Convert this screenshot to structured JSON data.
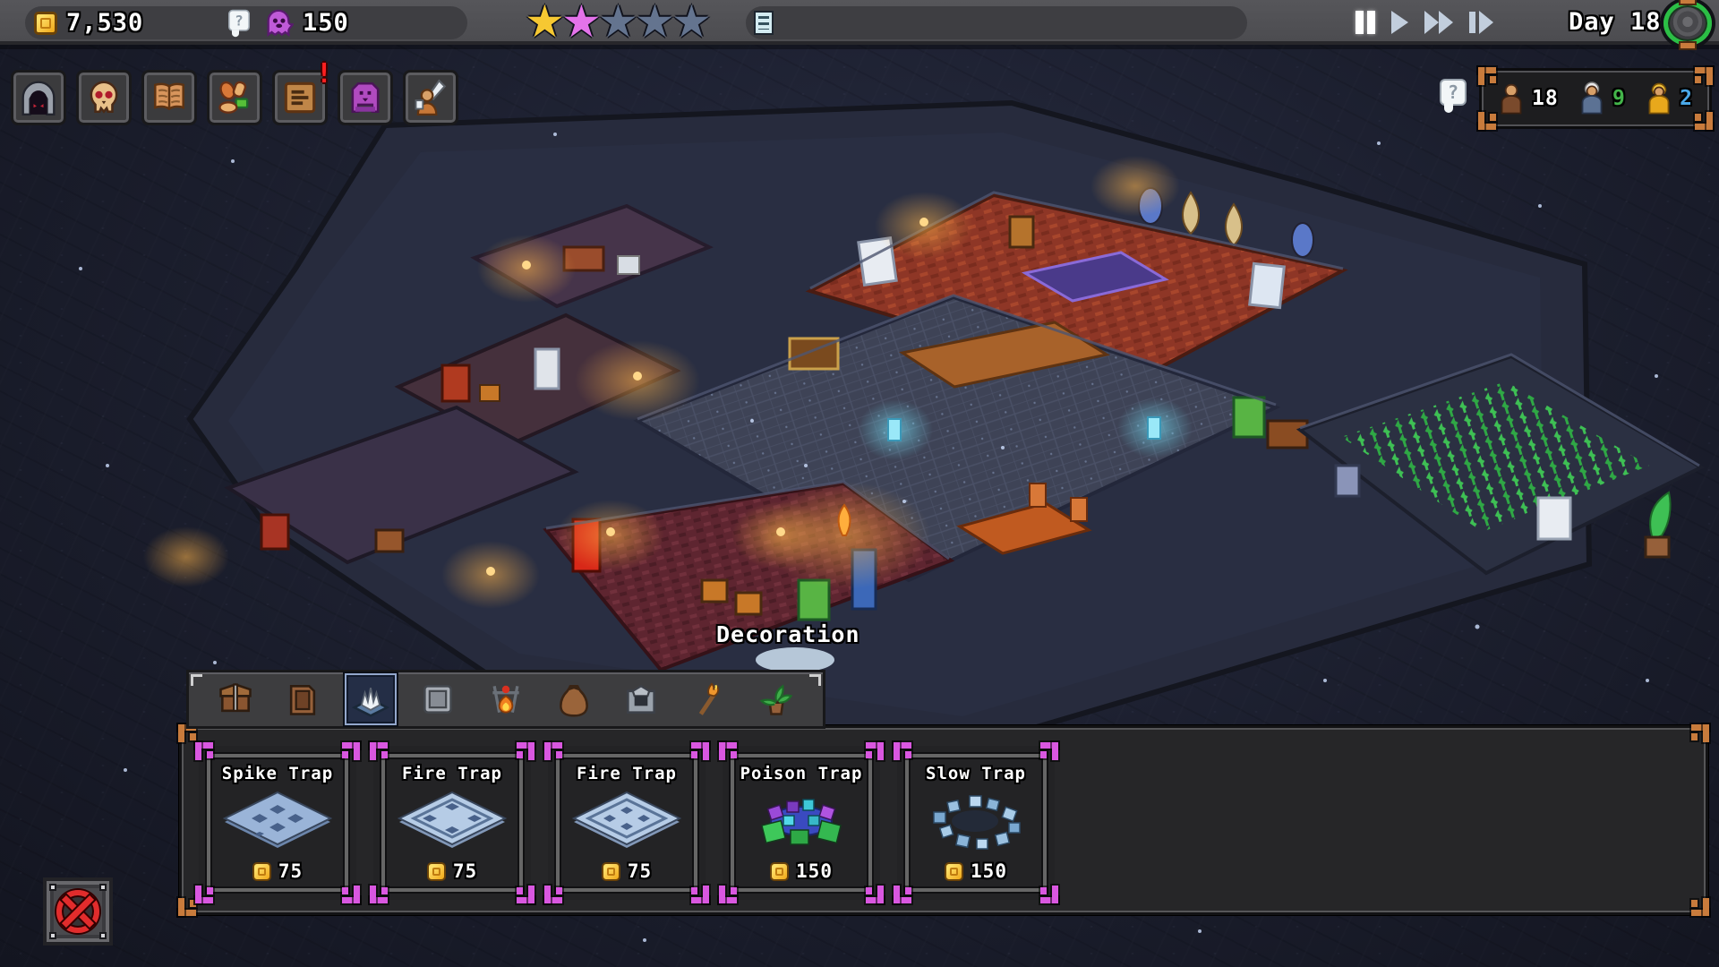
{
  "hud": {
    "gold": "7,530",
    "souls": "150",
    "day": "Day 18",
    "stars": [
      "gold",
      "pink",
      "empty",
      "empty",
      "empty"
    ],
    "playback": {
      "state": "paused",
      "buttons": [
        "pause",
        "play",
        "fast-forward",
        "step-forward"
      ]
    },
    "quest_bar": {
      "icon": "quest-list-icon",
      "value": ""
    }
  },
  "toolbar": {
    "items": [
      {
        "icon": "dungeon-gate"
      },
      {
        "icon": "skull-minions"
      },
      {
        "icon": "codex-book"
      },
      {
        "icon": "food-resources"
      },
      {
        "icon": "notice-board",
        "badge": "!"
      },
      {
        "icon": "dark-altar"
      },
      {
        "icon": "hero-invasion"
      }
    ]
  },
  "population": {
    "help_icon": "?",
    "items": [
      {
        "icon": "worker-figure",
        "count": "18",
        "color": "#ffffff"
      },
      {
        "icon": "elder-figure",
        "count": "9",
        "color": "#43b54a"
      },
      {
        "icon": "hero-figure",
        "count": "2",
        "color": "#4aa8e8"
      }
    ]
  },
  "tooltip": {
    "label": "Decoration"
  },
  "build_menu": {
    "selected_tab_index": 2,
    "tabs": [
      {
        "icon": "chest"
      },
      {
        "icon": "door"
      },
      {
        "icon": "spike-trap",
        "selected": true
      },
      {
        "icon": "pressure-plate"
      },
      {
        "icon": "campfire"
      },
      {
        "icon": "sack"
      },
      {
        "icon": "furnace"
      },
      {
        "icon": "torch"
      },
      {
        "icon": "potted-plant"
      }
    ],
    "cards": [
      {
        "title": "Spike Trap",
        "price": "75",
        "icon": "spike-trap-plate"
      },
      {
        "title": "Fire Trap",
        "price": "75",
        "icon": "fire-trap-plate"
      },
      {
        "title": "Fire Trap",
        "price": "75",
        "icon": "fire-trap-plate"
      },
      {
        "title": "Poison Trap",
        "price": "150",
        "icon": "poison-trap"
      },
      {
        "title": "Slow Trap",
        "price": "150",
        "icon": "slow-trap"
      }
    ]
  },
  "cancel": {
    "icon": "cancel-x"
  },
  "colors": {
    "gold_star": "#f6c832",
    "pink_star": "#e473ea",
    "empty_star": "#64748f",
    "card_corner": "#d957e0",
    "panel_corner": "#c87b3c",
    "badge_red": "#ff2020",
    "pop_green": "#43b54a",
    "pop_blue": "#4aa8e8",
    "orb_green": "#2bbf45"
  }
}
